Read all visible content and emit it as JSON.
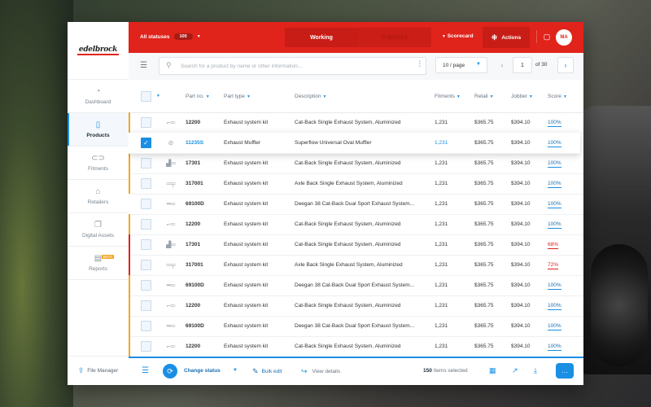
{
  "app": {
    "logo_text": "edelbrock"
  },
  "sidebar": {
    "items": [
      {
        "label": "Dashboard",
        "icon": "gauge-icon"
      },
      {
        "label": "Products",
        "icon": "product-icon"
      },
      {
        "label": "Fitments",
        "icon": "car-icon"
      },
      {
        "label": "Retailers",
        "icon": "store-icon"
      },
      {
        "label": "Digital Assets",
        "icon": "files-icon"
      },
      {
        "label": "Reports",
        "icon": "report-icon",
        "badge": "BETA"
      }
    ],
    "file_manager": "File Manager"
  },
  "topbar": {
    "status_filter": "All statuses",
    "status_count": "100",
    "tabs": [
      "Working",
      "Published"
    ],
    "scorecard": "Scorecard",
    "actions": "Actions",
    "avatar_initials": "MA",
    "accent_color": "#e0231b"
  },
  "toolbar": {
    "search_placeholder": "Search for a product by name or other information...",
    "per_page": "10 / page",
    "current_page": "1",
    "page_of": "of",
    "total_pages": "30"
  },
  "table": {
    "headers": {
      "part_no": "Part no.",
      "part_type": "Part type",
      "description": "Description",
      "fitments": "Fitments",
      "retail": "Retail",
      "jobber": "Jobber",
      "score": "Score"
    },
    "rows": [
      {
        "part_no": "12200",
        "part_type": "Exhaust system kit",
        "description": "Cat-Back Single Exhaust System, Aluminized",
        "fitments": "1,231",
        "retail": "$365.75",
        "jobber": "$394.10",
        "score": "100%"
      },
      {
        "part_no": "11235S",
        "part_type": "Exhaust Muffler",
        "description": "Superflow Universal Oval Muffler",
        "fitments": "1,231",
        "retail": "$365.75",
        "jobber": "$394.10",
        "score": "100%"
      },
      {
        "part_no": "17301",
        "part_type": "Exhaust system kit",
        "description": "Cat-Back Single Exhaust System, Aluminized",
        "fitments": "1,231",
        "retail": "$365.75",
        "jobber": "$394.10",
        "score": "100%"
      },
      {
        "part_no": "317001",
        "part_type": "Exhaust system kit",
        "description": "Axle Back Single Exhaust System, Aluminized",
        "fitments": "1,231",
        "retail": "$365.75",
        "jobber": "$394.10",
        "score": "100%"
      },
      {
        "part_no": "69100D",
        "part_type": "Exhaust system kit",
        "description": "Deegan 38 Cat-Back Dual Sport Exhaust System...",
        "fitments": "1,231",
        "retail": "$365.75",
        "jobber": "$394.10",
        "score": "100%"
      },
      {
        "part_no": "12200",
        "part_type": "Exhaust system kit",
        "description": "Cat-Back Single Exhaust System, Aluminized",
        "fitments": "1,231",
        "retail": "$365.75",
        "jobber": "$394.10",
        "score": "100%"
      },
      {
        "part_no": "17301",
        "part_type": "Exhaust system kit",
        "description": "Cat-Back Single Exhaust System, Aluminized",
        "fitments": "1,231",
        "retail": "$365.75",
        "jobber": "$394.10",
        "score": "68%"
      },
      {
        "part_no": "317001",
        "part_type": "Exhaust system kit",
        "description": "Axle Back Single Exhaust System, Aluminized",
        "fitments": "1,231",
        "retail": "$365.75",
        "jobber": "$394.10",
        "score": "72%"
      },
      {
        "part_no": "69100D",
        "part_type": "Exhaust system kit",
        "description": "Deegan 38 Cat-Back Dual Sport Exhaust System...",
        "fitments": "1,231",
        "retail": "$365.75",
        "jobber": "$394.10",
        "score": "100%"
      },
      {
        "part_no": "12200",
        "part_type": "Exhaust system kit",
        "description": "Cat-Back Single Exhaust System, Aluminized",
        "fitments": "1,231",
        "retail": "$365.75",
        "jobber": "$394.10",
        "score": "100%"
      },
      {
        "part_no": "69100D",
        "part_type": "Exhaust system kit",
        "description": "Deegan 38 Cat-Back Dual Sport Exhaust System...",
        "fitments": "1,231",
        "retail": "$365.75",
        "jobber": "$394.10",
        "score": "100%"
      },
      {
        "part_no": "12200",
        "part_type": "Exhaust system kit",
        "description": "Cat-Back Single Exhaust System, Aluminized",
        "fitments": "1,231",
        "retail": "$365.75",
        "jobber": "$394.10",
        "score": "100%"
      }
    ]
  },
  "bottombar": {
    "change_status": "Change status",
    "bulk_edit": "Bulk edit",
    "view_details": "View details",
    "selected_count": "150",
    "selected_label": "Items selected"
  }
}
